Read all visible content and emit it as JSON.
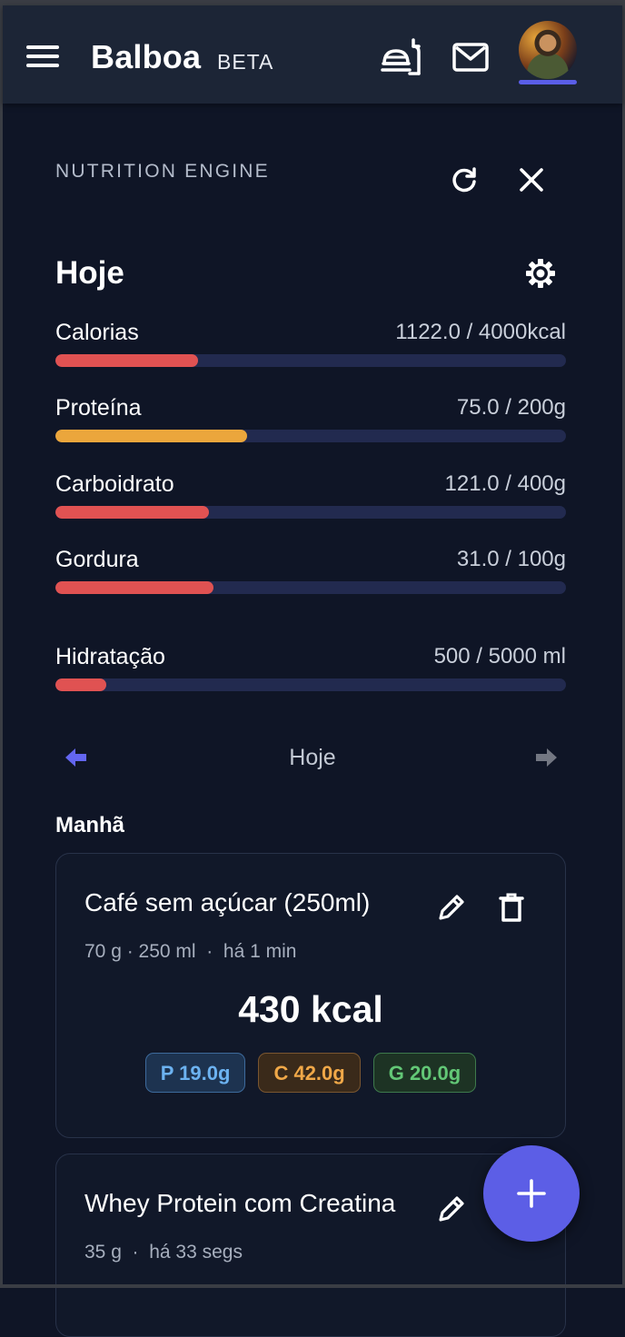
{
  "header": {
    "brand": "Balboa",
    "badge": "BETA",
    "icons": [
      "menu-icon",
      "food-tray-icon",
      "mail-icon",
      "avatar"
    ]
  },
  "panel": {
    "section_label": "NUTRITION ENGINE",
    "title": "Hoje"
  },
  "stats": [
    {
      "label": "Calorias",
      "value": "1122.0 / 4000kcal",
      "progress": 0.28,
      "color": "#e05252"
    },
    {
      "label": "Proteína",
      "value": "75.0 / 200g",
      "progress": 0.375,
      "color": "#eba63c"
    },
    {
      "label": "Carboidrato",
      "value": "121.0 / 400g",
      "progress": 0.3,
      "color": "#e05252"
    },
    {
      "label": "Gordura",
      "value": "31.0 / 100g",
      "progress": 0.31,
      "color": "#e05252"
    },
    {
      "label": "Hidratação",
      "value": "500 / 5000 ml",
      "progress": 0.1,
      "color": "#e05252"
    }
  ],
  "date_nav": {
    "label": "Hoje"
  },
  "meal_group": {
    "label": "Manhã"
  },
  "entries": [
    {
      "name": "Café sem açúcar (250ml)",
      "meta": "70 g · 250 ml  ·  há 1 min",
      "kcal": "430 kcal",
      "protein": "P 19.0g",
      "carbs": "C 42.0g",
      "fat": "G 20.0g"
    },
    {
      "name": "Whey Protein com Creatina",
      "meta": "35 g  ·  há 33 segs"
    }
  ],
  "colors": {
    "accent": "#5c5ee6",
    "background": "#0f1526",
    "topbar": "#1c2536"
  }
}
